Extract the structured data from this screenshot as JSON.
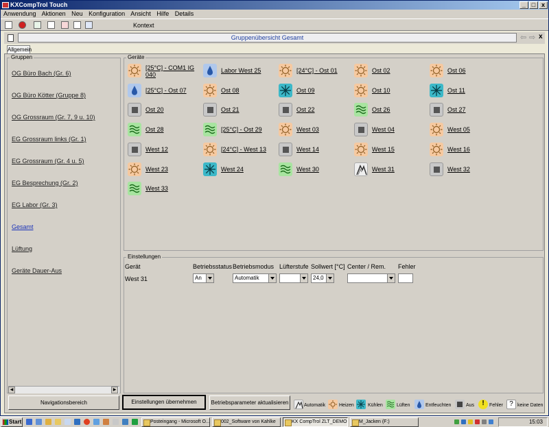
{
  "window": {
    "title": "KXCompTrol Touch",
    "min": "_",
    "max": "□",
    "close": "x"
  },
  "menu": [
    "Anwendung",
    "Aktionen",
    "Neu",
    "Konfiguration",
    "Ansicht",
    "Hilfe",
    "Details"
  ],
  "toolbar": {
    "context_label": "Kontext"
  },
  "header": {
    "title": "Gruppenübersicht Gesamt",
    "back": "⇦",
    "fwd": "⇨",
    "close": "x"
  },
  "tab": {
    "label": "Allgemein"
  },
  "groups": {
    "legend": "Gruppen",
    "items": [
      "OG Büro Bach (Gr. 6)",
      "OG Büro Kötter (Gruppe 8)",
      "OG Grossraum (Gr. 7, 9 u. 10)",
      "EG Grossraum links (Gr. 1)",
      "EG Grossraum (Gr. 4 u. 5)",
      "EG Besprechung (Gr. 2)",
      "EG Labor (Gr. 3)",
      "Gesamt",
      "Lüftung",
      "Geräte Dauer-Aus"
    ],
    "active": "Gesamt"
  },
  "devices": {
    "legend": "Geräte",
    "items": [
      {
        "label": "[25°C] - COM1 IG 040",
        "mode": "heat"
      },
      {
        "label": "Labor West 25",
        "mode": "drop"
      },
      {
        "label": "[24°C] - Ost 01",
        "mode": "heat"
      },
      {
        "label": "Ost 02",
        "mode": "heat"
      },
      {
        "label": "Ost 06",
        "mode": "heat"
      },
      {
        "label": "[25°C] - Ost 07",
        "mode": "drop"
      },
      {
        "label": "Ost 08",
        "mode": "heat"
      },
      {
        "label": "Ost 09",
        "mode": "cool"
      },
      {
        "label": "Ost 10",
        "mode": "heat"
      },
      {
        "label": "Ost 11",
        "mode": "cool"
      },
      {
        "label": "Ost 20",
        "mode": "off"
      },
      {
        "label": "Ost 21",
        "mode": "off"
      },
      {
        "label": "Ost 22",
        "mode": "off"
      },
      {
        "label": "Ost 26",
        "mode": "fan"
      },
      {
        "label": "Ost 27",
        "mode": "off"
      },
      {
        "label": "Ost 28",
        "mode": "fan"
      },
      {
        "label": "[25°C] - Ost 29",
        "mode": "fan"
      },
      {
        "label": "West 03",
        "mode": "heat"
      },
      {
        "label": "West 04",
        "mode": "off"
      },
      {
        "label": "West 05",
        "mode": "heat"
      },
      {
        "label": "West 12",
        "mode": "off"
      },
      {
        "label": "[24°C] - West 13",
        "mode": "heat"
      },
      {
        "label": "West 14",
        "mode": "off"
      },
      {
        "label": "West 15",
        "mode": "heat"
      },
      {
        "label": "West 16",
        "mode": "heat"
      },
      {
        "label": "West 23",
        "mode": "heat"
      },
      {
        "label": "West 24",
        "mode": "cool"
      },
      {
        "label": "West 30",
        "mode": "fan"
      },
      {
        "label": "West 31",
        "mode": "auto"
      },
      {
        "label": "West 32",
        "mode": "off"
      },
      {
        "label": "West 33",
        "mode": "fan"
      }
    ]
  },
  "settings": {
    "legend": "Einstellungen",
    "headers": {
      "geraet": "Gerät",
      "status": "Betriebsstatus",
      "modus": "Betriebsmodus",
      "luefter": "Lüfterstufe",
      "sollwert": "Sollwert [°C]",
      "center": "Center / Rem.",
      "fehler": "Fehler"
    },
    "row": {
      "geraet": "West 31",
      "status": "An",
      "modus": "Automatik",
      "luefter": "",
      "sollwert": "24,0",
      "center": "",
      "fehler": ""
    }
  },
  "buttons": {
    "nav": "Navigationsbereich",
    "apply": "Einstellungen übernehmen",
    "update": "Betriebsparameter aktualisieren"
  },
  "legend": {
    "auto": "Automatik",
    "heat": "Heizen",
    "cool": "Kühlen",
    "fan": "Lüften",
    "drop": "Entfeuchten",
    "off": "Aus",
    "error": "Fehler",
    "nodata": "keine Daten"
  },
  "taskbar": {
    "start": "Start",
    "tasks": [
      "Posteingang - Microsoft O...",
      "002_Software von Kahlke",
      "KX CompTrol ZLT_DEMO",
      "M_Jacken (F:)"
    ],
    "clock": "15:03"
  },
  "colors": {
    "heat": "#f6c9a0",
    "cool": "#3cb8c8",
    "fan": "#a8e4a0",
    "drop": "#b0c8ec",
    "off": "#c8c8c8",
    "active_link": "#1a32b8",
    "title_bar": "#0a246a"
  }
}
